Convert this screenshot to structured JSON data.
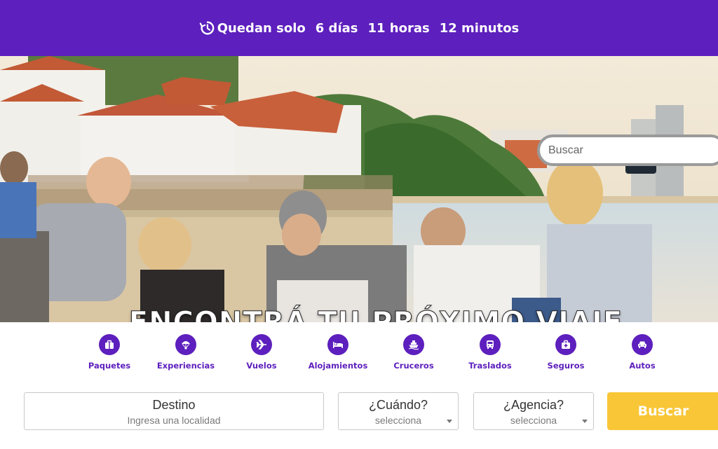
{
  "colors": {
    "brand_purple": "#5d1fbd",
    "cta_yellow": "#f8c637"
  },
  "countdown": {
    "icon": "history-clock-icon",
    "prefix": "Quedan solo",
    "days": "6 días",
    "hours": "11 horas",
    "minutes": "12 minutos"
  },
  "hero": {
    "title": "ENCONTRÁ TU PRÓXIMO VIAJE",
    "search_placeholder": "Buscar"
  },
  "categories": [
    {
      "label": "Paquetes",
      "icon": "suitcase-icon"
    },
    {
      "label": "Experiencias",
      "icon": "parachute-icon"
    },
    {
      "label": "Vuelos",
      "icon": "airplane-icon"
    },
    {
      "label": "Alojamientos",
      "icon": "bed-icon"
    },
    {
      "label": "Cruceros",
      "icon": "ship-icon"
    },
    {
      "label": "Traslados",
      "icon": "bus-icon"
    },
    {
      "label": "Seguros",
      "icon": "medical-case-icon"
    },
    {
      "label": "Autos",
      "icon": "car-icon"
    }
  ],
  "form": {
    "destino": {
      "label": "Destino",
      "placeholder": "Ingresa una localidad"
    },
    "cuando": {
      "label": "¿Cuándo?",
      "value": "selecciona"
    },
    "agencia": {
      "label": "¿Agencia?",
      "value": "selecciona"
    },
    "submit_label": "Buscar"
  }
}
